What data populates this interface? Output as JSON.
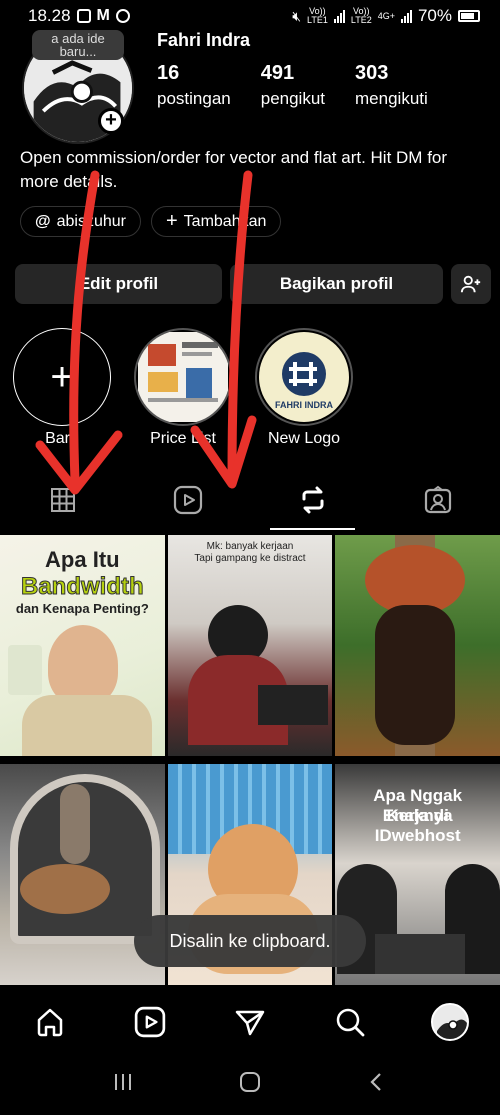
{
  "status_bar": {
    "time": "18.28",
    "sim1": "Vo))",
    "sim1_sub": "LTE1",
    "sim2": "Vo))",
    "sim2_sub": "LTE2",
    "network": "4G+",
    "battery": "70%"
  },
  "profile": {
    "note": "a ada ide baru...",
    "username": "Fahri Indra",
    "stats": [
      {
        "value": "16",
        "label": "postingan"
      },
      {
        "value": "491",
        "label": "pengikut"
      },
      {
        "value": "303",
        "label": "mengikuti"
      }
    ],
    "bio": "Open commission/order for vector and flat art. Hit DM for more details.",
    "threads_handle": "abiszuhur",
    "add_link_label": "Tambahkan",
    "edit_button": "Edit profil",
    "share_button": "Bagikan profil"
  },
  "highlights": [
    {
      "label": "Baru",
      "icon": "plus-icon"
    },
    {
      "label": "Price List",
      "icon": "price-list-thumbnail"
    },
    {
      "label": "New Logo",
      "icon": "fahri-indra-logo"
    }
  ],
  "highlight_logo_text": "FAHRI INDRA",
  "tabs": [
    "grid-icon",
    "reels-icon",
    "reposts-icon",
    "tagged-icon"
  ],
  "grid": [
    {
      "lines": [
        "Apa Itu",
        "Bandwidth",
        "dan Kenapa Penting?"
      ]
    },
    {
      "lines": [
        "Mk: banyak kerjaan",
        "Tapi gampang ke distract"
      ]
    },
    {
      "lines": []
    },
    {
      "lines": []
    },
    {
      "lines": []
    },
    {
      "lines": [
        "Apa Nggak Enaknya",
        "Kerja di IDwebhost"
      ]
    }
  ],
  "toast": "Disalin ke clipboard.",
  "bottom_nav": [
    "home-icon",
    "reels-icon",
    "send-icon",
    "search-icon",
    "profile-avatar"
  ],
  "colors": {
    "background": "#000000",
    "button": "#262626",
    "annotation_arrow": "#e8322b",
    "bandwidth_green": "#b6d10f"
  }
}
